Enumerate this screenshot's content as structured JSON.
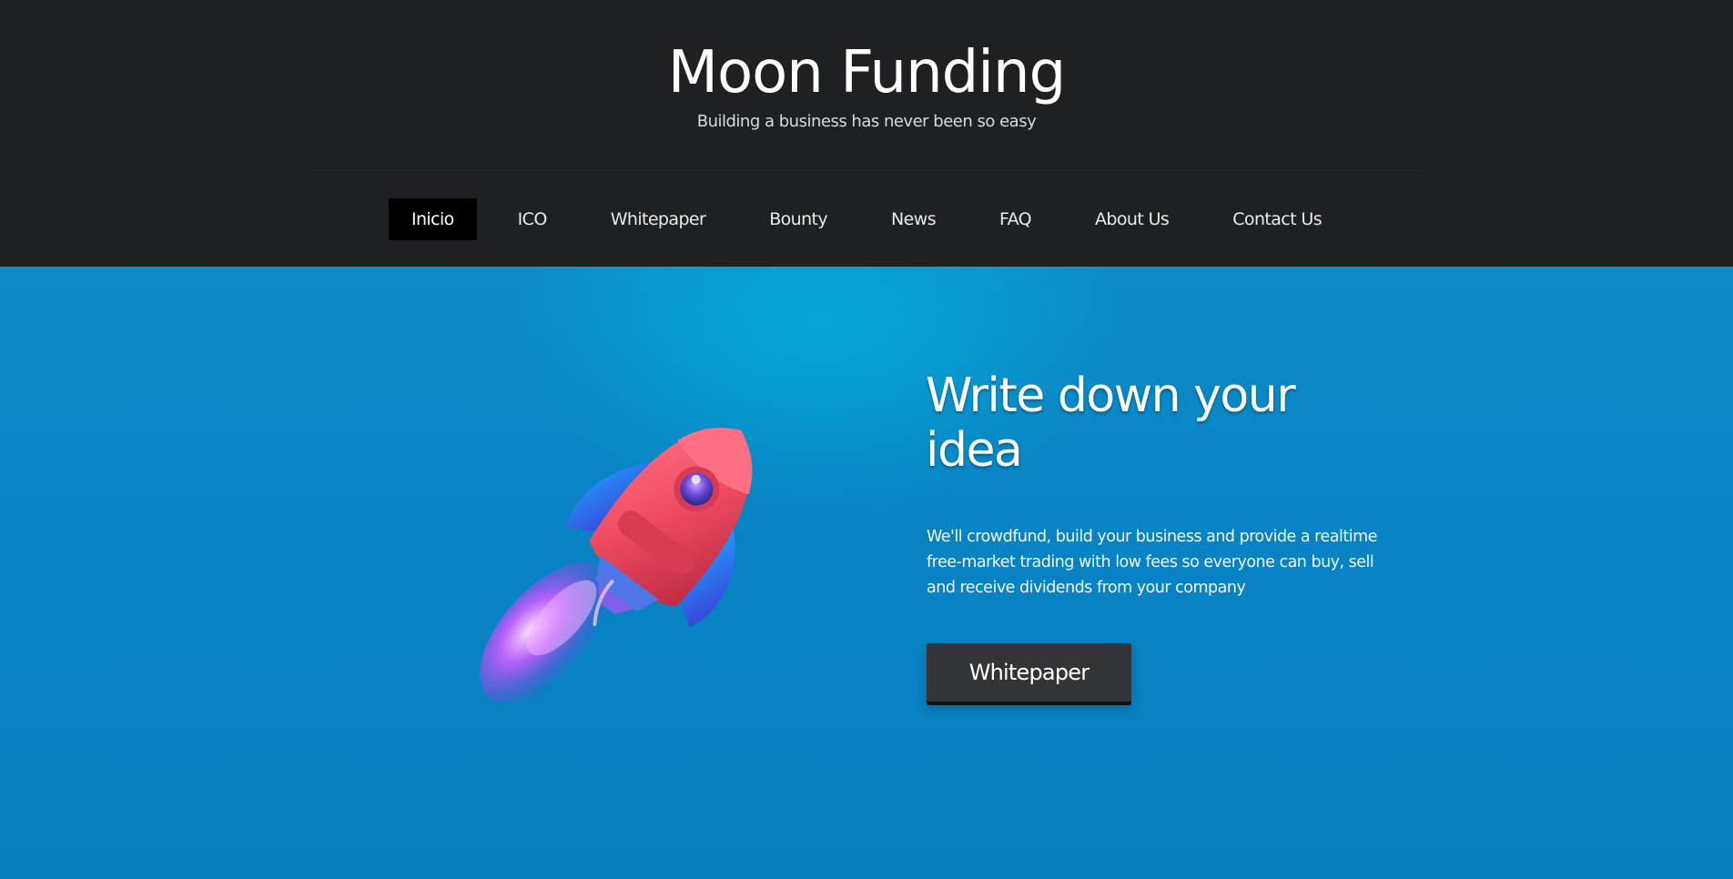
{
  "header": {
    "title": "Moon Funding",
    "tagline": "Building a business has never been so easy"
  },
  "nav": {
    "items": [
      {
        "label": "Inicio",
        "active": true
      },
      {
        "label": "ICO"
      },
      {
        "label": "Whitepaper"
      },
      {
        "label": "Bounty"
      },
      {
        "label": "News"
      },
      {
        "label": "FAQ"
      },
      {
        "label": "About Us"
      },
      {
        "label": "Contact Us"
      }
    ]
  },
  "hero": {
    "title": "Write down your idea",
    "description": "We'll crowdfund, build your business and provide a realtime free-market trading with low fees so everyone can buy, sell and receive dividends from your company",
    "button_label": "Whitepaper",
    "illustration": "rocket-illustration"
  },
  "colors": {
    "header_bg": "#1f2024",
    "active_nav_bg": "#000000",
    "hero_bg": "#0783c4",
    "button_bg": "#333438"
  }
}
